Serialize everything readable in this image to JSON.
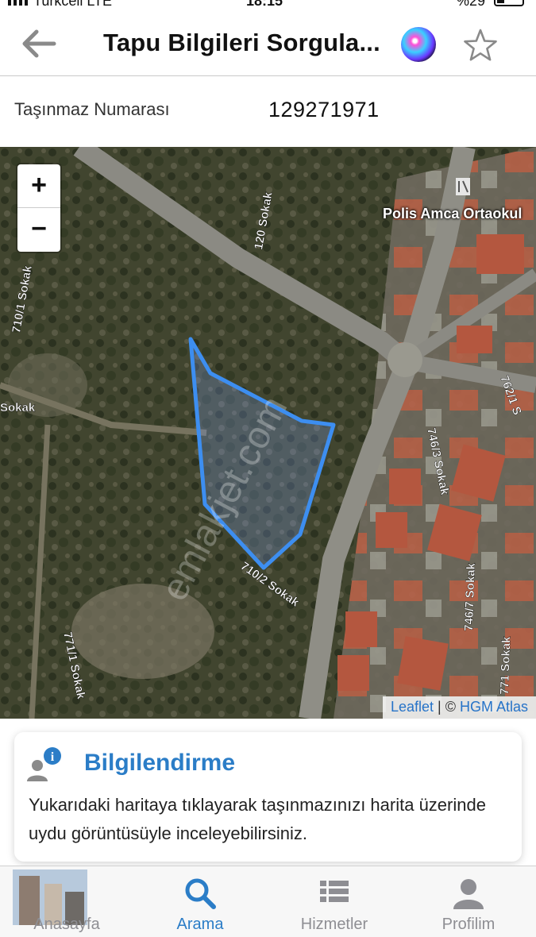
{
  "status_bar": {
    "carrier": "Turkcell LTE",
    "time": "18:15",
    "battery": "%29"
  },
  "nav": {
    "title": "Tapu Bilgileri Sorgula...",
    "back_icon": "back-arrow-icon",
    "siri_icon": "siri-icon",
    "favorite_icon": "star-icon"
  },
  "parcel": {
    "label": "Taşınmaz Numarası",
    "value": "129271971"
  },
  "map": {
    "zoom_in_label": "+",
    "zoom_out_label": "−",
    "poi_label": "Polis Amca Ortaokul",
    "street_labels": [
      "120 Sokak",
      "710/1 Sokak",
      "Sokak",
      "710/2 Sokak",
      "771/1 Sokak",
      "746/3 Sokak",
      "762/1 S",
      "746/7 Sokak",
      "771 Sokak"
    ],
    "watermark": "emlakjet.com",
    "attribution_leaflet": "Leaflet",
    "attribution_separator": " | © ",
    "attribution_source": "HGM Atlas",
    "parcel_outline_color": "#3d8ef0"
  },
  "info_card": {
    "icon": "user-info-icon",
    "title": "Bilgilendirme",
    "body": "Yukarıdaki haritaya tıklayarak taşınmazınızı harita üzerinde uydu görüntüsüyle inceleyebilirsiniz."
  },
  "tabbar": {
    "tabs": [
      {
        "label": "Anasayfa",
        "icon": "home-thumbnail",
        "active": false
      },
      {
        "label": "Arama",
        "icon": "search-icon",
        "active": true
      },
      {
        "label": "Hizmetler",
        "icon": "list-icon",
        "active": false
      },
      {
        "label": "Profilim",
        "icon": "person-icon",
        "active": false
      }
    ]
  },
  "colors": {
    "accent": "#2b7dc7",
    "inactive_tab": "#8e8e93"
  }
}
